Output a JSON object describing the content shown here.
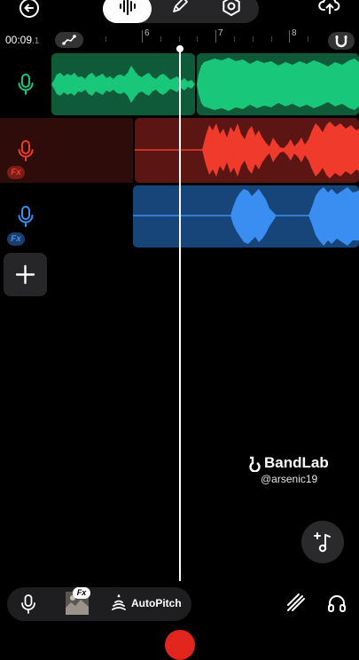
{
  "timeline": {
    "time": "00:09",
    "time_fraction": ".1",
    "bars": [
      "6",
      "7",
      "8"
    ]
  },
  "tracks": [
    {
      "name": "track-1",
      "color": "#19c77b",
      "dark": "#0f5a38",
      "fx": false
    },
    {
      "name": "track-2",
      "color": "#f03a2c",
      "dark": "#5b1613",
      "fx": true
    },
    {
      "name": "track-3",
      "color": "#3a8ef2",
      "dark": "#17457a",
      "fx": true
    }
  ],
  "fx_label": "Fx",
  "watermark": {
    "brand": "BandLab",
    "handle": "@arsenic19"
  },
  "bottom_bar": {
    "fx_badge": "Fx",
    "autopitch_label": "AutoPitch"
  },
  "icons": {
    "top": [
      "back-arrow-icon",
      "waveform-icon",
      "pen-icon",
      "settings-icon",
      "cloud-upload-icon"
    ],
    "timeline": [
      "automation-icon",
      "magnet-icon"
    ],
    "bottom": [
      "mic-icon",
      "autopitch-icon",
      "tuner-icon",
      "headphones-icon"
    ]
  }
}
